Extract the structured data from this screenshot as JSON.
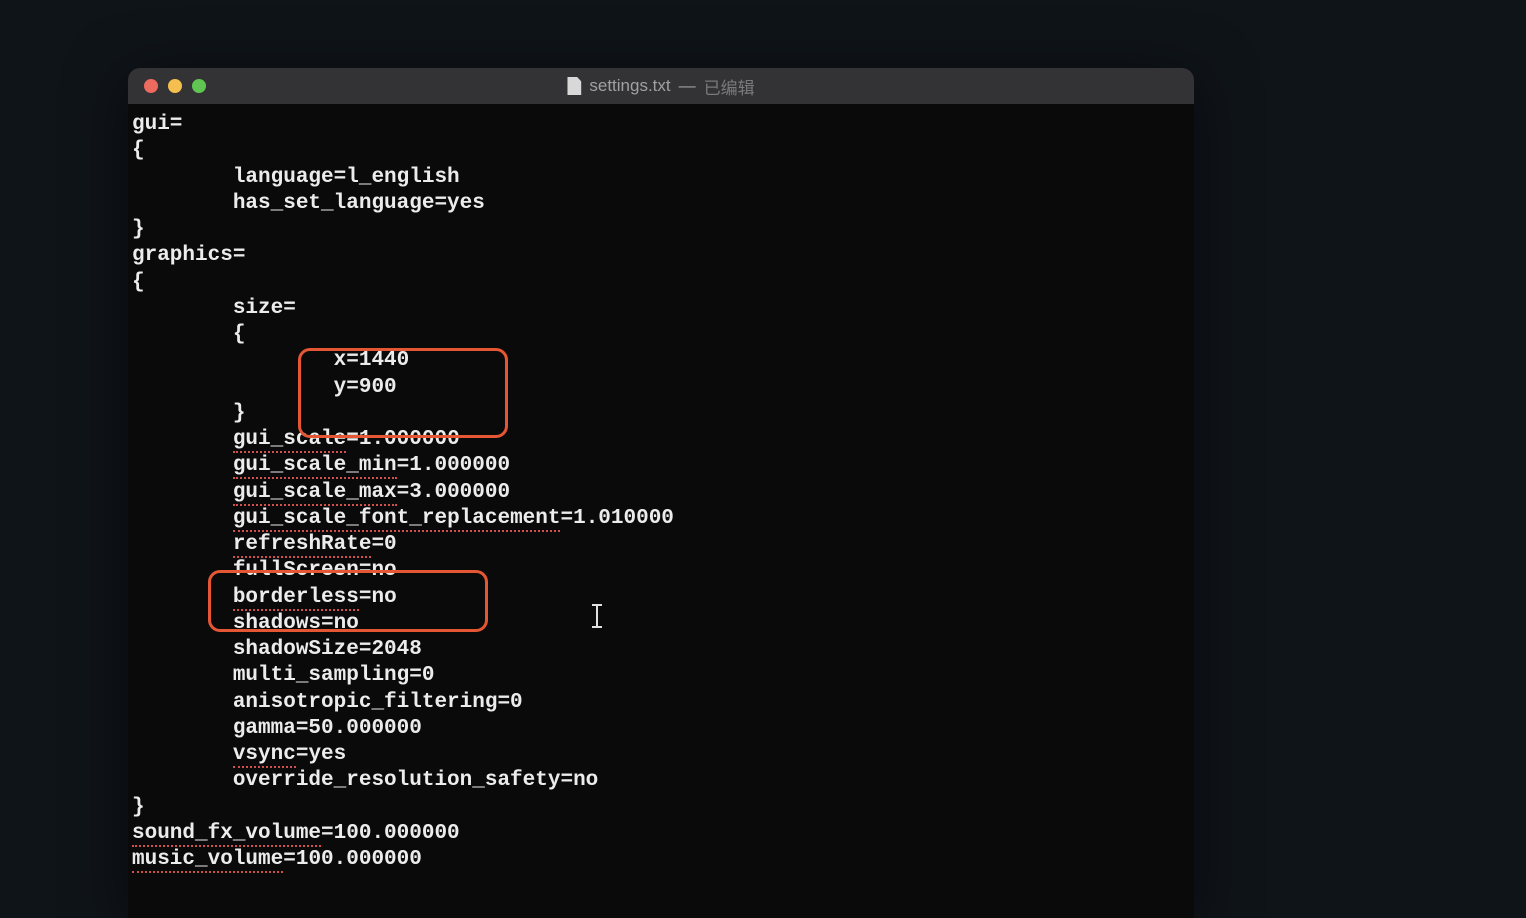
{
  "window": {
    "filename": "settings.txt",
    "edited_label": "已编辑"
  },
  "content": {
    "l1": "gui=",
    "l2": "{",
    "l3": "        language=l_english",
    "l4": "        has_set_language=yes",
    "l5": "}",
    "l6": "graphics=",
    "l7": "{",
    "l8": "        size=",
    "l9": "        {",
    "l10": "                x=1440",
    "l11": "                y=900",
    "l12": "        }",
    "l13": "",
    "l14_a": "        ",
    "l14_b": "gui_scale",
    "l14_c": "=1.000000",
    "l15_a": "        ",
    "l15_b": "gui_scale_min",
    "l15_c": "=1.000000",
    "l16_a": "        ",
    "l16_b": "gui_scale_max",
    "l16_c": "=3.000000",
    "l17_a": "        ",
    "l17_b": "gui_scale_font_replacement",
    "l17_c": "=1.010000",
    "l18_a": "        ",
    "l18_b": "refreshRate",
    "l18_c": "=0",
    "l19": "        fullScreen=no",
    "l20_a": "        ",
    "l20_b": "borderless",
    "l20_c": "=no",
    "l21": "        shadows=no",
    "l22": "        shadowSize=2048",
    "l23": "        multi_sampling=0",
    "l24": "        anisotropic_filtering=0",
    "l25": "        gamma=50.000000",
    "l26_a": "        ",
    "l26_b": "vsync",
    "l26_c": "=yes",
    "l27": "        override_resolution_safety=no",
    "l28": "}",
    "l29_a": "sound_fx_volume",
    "l29_b": "=100.000000",
    "l30_a": "music_volume",
    "l30_b": "=100.000000"
  }
}
